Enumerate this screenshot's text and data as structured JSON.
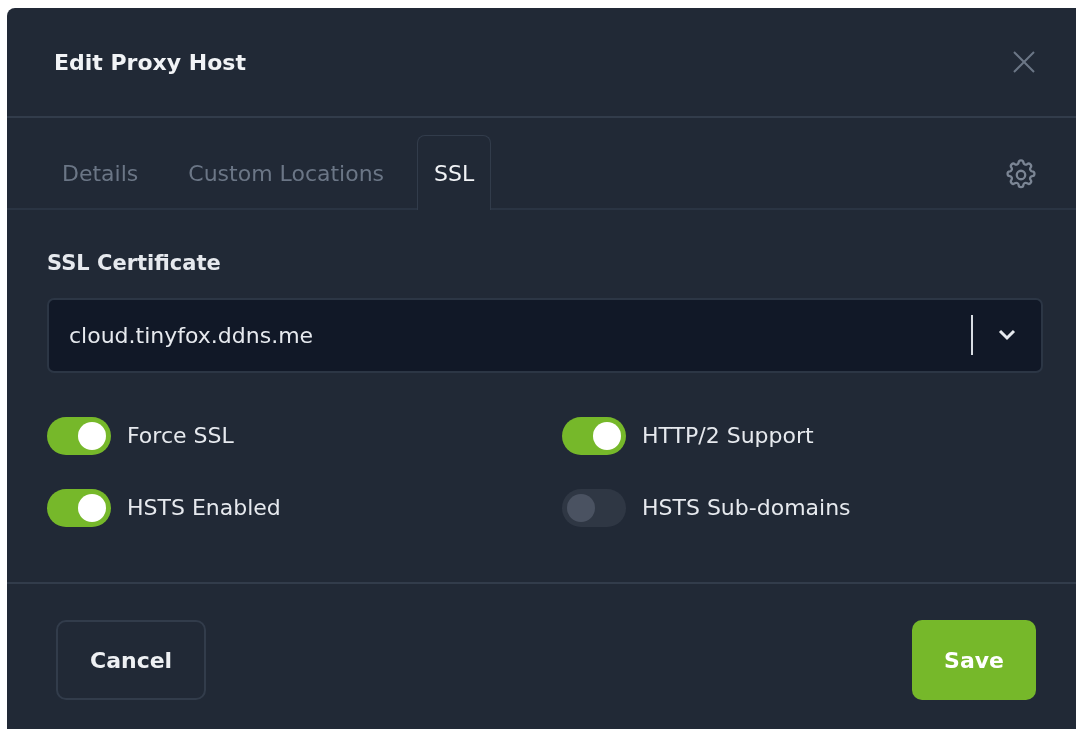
{
  "modal": {
    "title": "Edit Proxy Host"
  },
  "tabs": [
    {
      "label": "Details",
      "selected": false
    },
    {
      "label": "Custom Locations",
      "selected": false
    },
    {
      "label": "SSL",
      "selected": true
    }
  ],
  "ssl_certificate": {
    "label": "SSL Certificate",
    "value": "cloud.tinyfox.ddns.me"
  },
  "switches": [
    {
      "label": "Force SSL",
      "on": true
    },
    {
      "label": "HTTP/2 Support",
      "on": true
    },
    {
      "label": "HSTS Enabled",
      "on": true
    },
    {
      "label": "HSTS Sub-domains",
      "on": false
    }
  ],
  "buttons": [
    {
      "label": "Cancel",
      "kind": "secondary"
    },
    {
      "label": "Save",
      "kind": "primary"
    }
  ]
}
